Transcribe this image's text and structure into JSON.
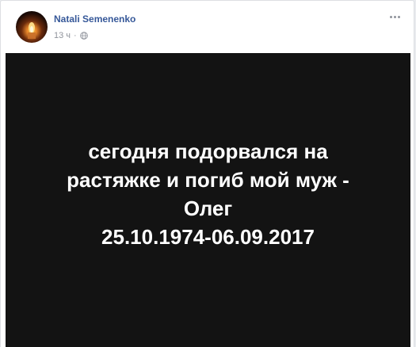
{
  "post": {
    "author": "Natali Semenenko",
    "time": "13 ч",
    "separator": "·",
    "privacy_icon": "globe-icon",
    "more_icon": "more-options-icon",
    "image_text": {
      "line1": "сегодня подорвался на",
      "line2": "растяжке и погиб мой муж -",
      "line3": "Олег",
      "line4": "25.10.1974-06.09.2017"
    }
  },
  "colors": {
    "author_link": "#365899",
    "meta": "#90949c",
    "image_background": "#131313",
    "image_text": "#ffffff"
  }
}
